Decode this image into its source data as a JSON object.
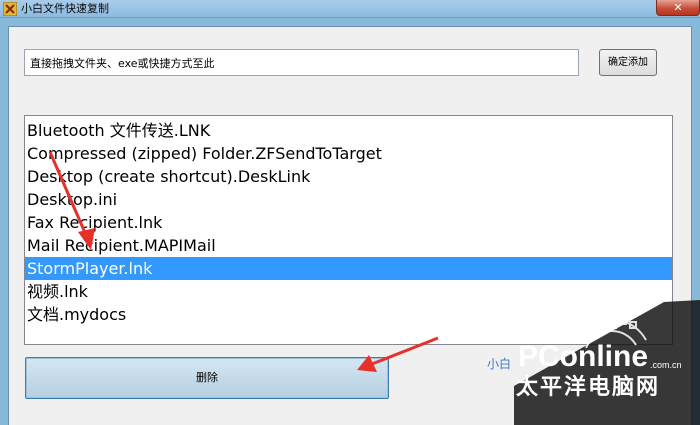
{
  "window": {
    "title": "小白文件快速复制",
    "close_glyph": "✕"
  },
  "toolbar": {
    "path_input_value": "直接拖拽文件夹、exe或快捷方式至此",
    "add_button_label": "确定添加"
  },
  "file_list": {
    "items": [
      "Bluetooth 文件传送.LNK",
      "Compressed (zipped) Folder.ZFSendToTarget",
      "Desktop (create shortcut).DeskLink",
      "Desktop.ini",
      "Fax Recipient.lnk",
      "Mail Recipient.MAPIMail",
      "StormPlayer.lnk",
      "视频.lnk",
      "文档.mydocs"
    ],
    "selected_index": 6
  },
  "actions": {
    "delete_button_label": "删除"
  },
  "footer": {
    "label": "小白"
  },
  "watermark": {
    "brand": "PConline",
    "domain": ".com.cn",
    "cn_name": "太平洋电脑网"
  },
  "colors": {
    "selection": "#3399ff",
    "annotation_arrow": "#e8302a",
    "watermark": "#ffffff"
  }
}
